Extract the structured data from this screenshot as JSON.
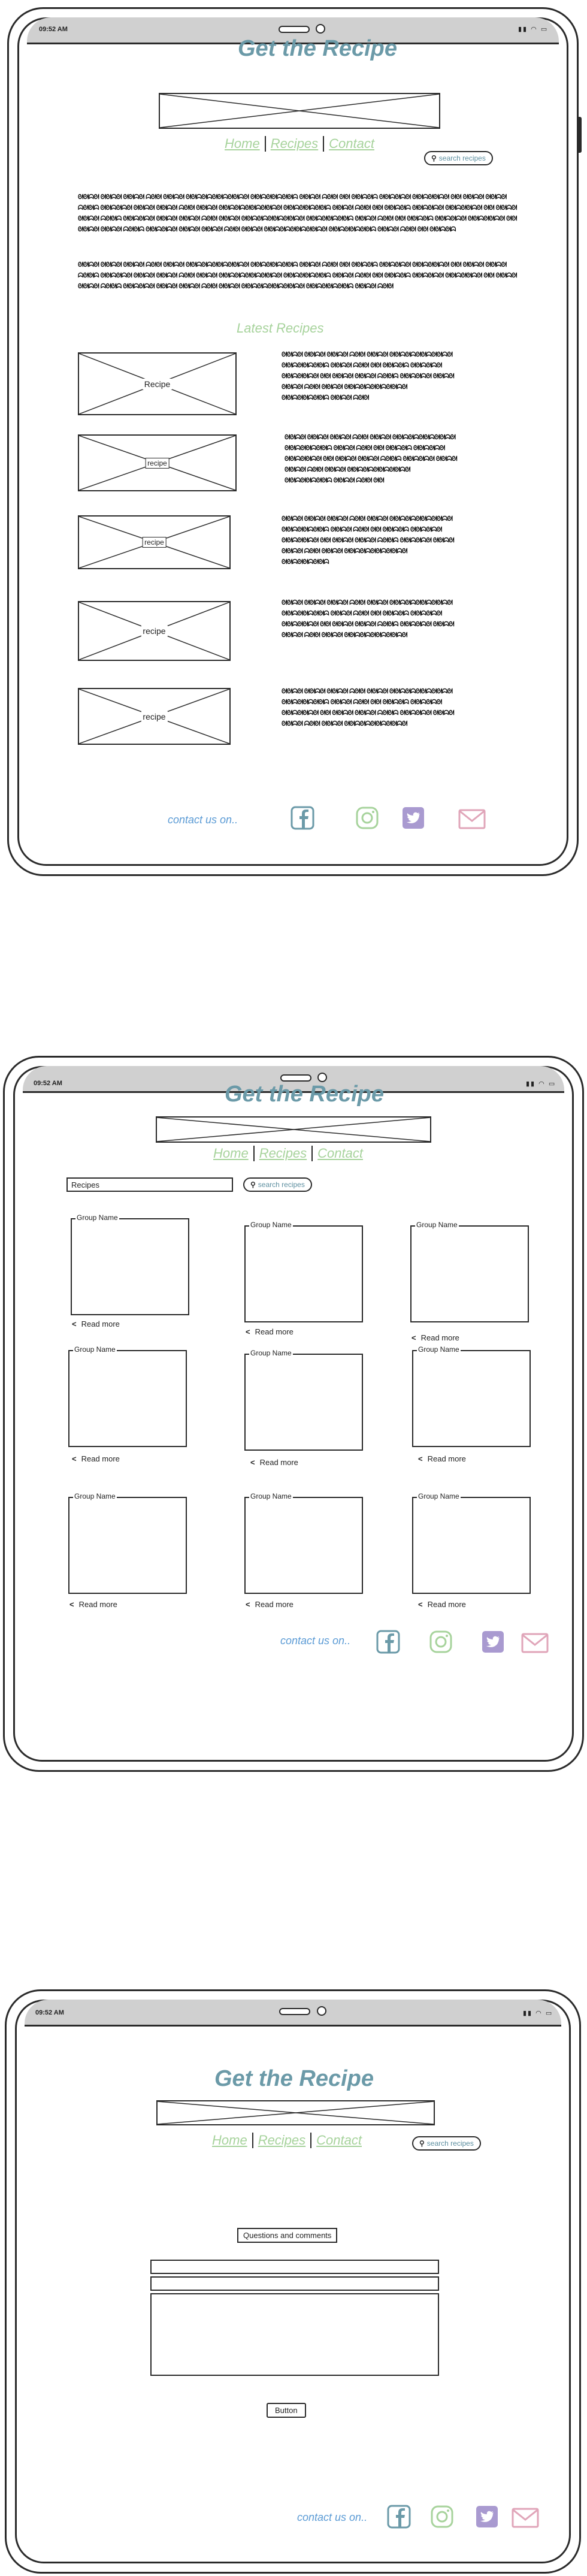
{
  "status": {
    "time": "09:52 AM",
    "icons": "▮▮ ◠ ▭"
  },
  "app": {
    "title": "Get the Recipe"
  },
  "nav": {
    "home": "Home",
    "recipes": "Recipes",
    "contact": "Contact"
  },
  "search": {
    "label": "search recipes",
    "icon": "search-icon"
  },
  "home": {
    "intro_p1": "ᘛᘛᗣᘛ ᘛᘛᗣᘛ ᘛᘛᗣᘛ ᗣᘛᘛ ᘛᘛᗣᘛ ᘛᘛᗣᘛᗣᘛᘛᗣᘛᘛᗣᘛ ᘛᘛᗣᘛᘛᗣᘛᘛᗣ ᘛᘛᗣᘛ ᗣᘛᘛ ᘛᘛ ᘛᘛᗣᘛᗣ ᘛᘛᗣᘛᗣᘛ ᘛᘛᗣᘛᘛᗣᘛ ᘛᘛ ᘛᘛᗣᘛ ᘛᘛᗣᘛ ᗣᘛᘛᗣ ᘛᘛᗣᘛᗣᘛ ᘛᘛᗣᘛ ᘛᘛᗣᘛ ᗣᘛᘛ ᘛᘛᗣᘛ ᘛᘛᗣᘛᗣᘛᘛᗣᘛᘛᗣᘛ ᘛᘛᗣᘛᘛᗣᘛᘛᗣ ᘛᘛᗣᘛ ᗣᘛᘛ ᘛᘛ ᘛᘛᗣᘛᗣ ᘛᘛᗣᘛᗣᘛ ᘛᘛᗣᘛᘛᗣᘛ ᘛᘛ ᘛᘛᗣᘛ ᘛᘛᗣᘛ ᗣᘛᘛᗣ ᘛᘛᗣᘛᗣᘛ ᘛᘛᗣᘛ ᘛᘛᗣᘛ ᗣᘛᘛ ᘛᘛᗣᘛ ᘛᘛᗣᘛᗣᘛᘛᗣᘛᘛᗣᘛ ᘛᘛᗣᘛᘛᗣᘛᘛᗣ ᘛᘛᗣᘛ ᗣᘛᘛ ᘛᘛ ᘛᘛᗣᘛᗣ ᘛᘛᗣᘛᗣᘛ ᘛᘛᗣᘛᘛᗣᘛ ᘛᘛ ᘛᘛᗣᘛ ᘛᘛᗣᘛ ᗣᘛᘛᗣ ᘛᘛᗣᘛᗣᘛ ᘛᘛᗣᘛ ᘛᘛᗣᘛ ᗣᘛᘛ ᘛᘛᗣᘛ ᘛᘛᗣᘛᗣᘛᘛᗣᘛᘛᗣᘛ ᘛᘛᗣᘛᘛᗣᘛᘛᗣ ᘛᘛᗣᘛ ᗣᘛᘛ ᘛᘛ ᘛᘛᗣᘛᗣ",
    "intro_p2": "ᘛᘛᗣᘛ ᘛᘛᗣᘛ ᘛᘛᗣᘛ ᗣᘛᘛ ᘛᘛᗣᘛ ᘛᘛᗣᘛᗣᘛᘛᗣᘛᘛᗣᘛ ᘛᘛᗣᘛᘛᗣᘛᘛᗣ ᘛᘛᗣᘛ ᗣᘛᘛ ᘛᘛ ᘛᘛᗣᘛᗣ ᘛᘛᗣᘛᗣᘛ ᘛᘛᗣᘛᘛᗣᘛ ᘛᘛ ᘛᘛᗣᘛ ᘛᘛᗣᘛ ᗣᘛᘛᗣ ᘛᘛᗣᘛᗣᘛ ᘛᘛᗣᘛ ᘛᘛᗣᘛ ᗣᘛᘛ ᘛᘛᗣᘛ ᘛᘛᗣᘛᗣᘛᘛᗣᘛᘛᗣᘛ ᘛᘛᗣᘛᘛᗣᘛᘛᗣ ᘛᘛᗣᘛ ᗣᘛᘛ ᘛᘛ ᘛᘛᗣᘛᗣ ᘛᘛᗣᘛᗣᘛ ᘛᘛᗣᘛᘛᗣᘛ ᘛᘛ ᘛᘛᗣᘛ ᘛᘛᗣᘛ ᗣᘛᘛᗣ ᘛᘛᗣᘛᗣᘛ ᘛᘛᗣᘛ ᘛᘛᗣᘛ ᗣᘛᘛ ᘛᘛᗣᘛ ᘛᘛᗣᘛᗣᘛᘛᗣᘛᘛᗣᘛ ᘛᘛᗣᘛᘛᗣᘛᘛᗣ ᘛᘛᗣᘛ ᗣᘛᘛ",
    "latest_title": "Latest Recipes",
    "recipes": [
      {
        "label": "Recipe",
        "desc": "ᘛᘛᗣᘛ ᘛᘛᗣᘛ ᘛᘛᗣᘛ ᗣᘛᘛ ᘛᘛᗣᘛ ᘛᘛᗣᘛᗣᘛᘛᗣᘛᘛᗣᘛ ᘛᘛᗣᘛᘛᗣᘛᘛᗣ ᘛᘛᗣᘛ ᗣᘛᘛ ᘛᘛ ᘛᘛᗣᘛᗣ ᘛᘛᗣᘛᗣᘛ ᘛᘛᗣᘛᘛᗣᘛ ᘛᘛ ᘛᘛᗣᘛ ᘛᘛᗣᘛ ᗣᘛᘛᗣ ᘛᘛᗣᘛᗣᘛ ᘛᘛᗣᘛ ᘛᘛᗣᘛ ᗣᘛᘛ ᘛᘛᗣᘛ ᘛᘛᗣᘛᗣᘛᘛᗣᘛᘛᗣᘛ ᘛᘛᗣᘛᘛᗣᘛᘛᗣ ᘛᘛᗣᘛ ᗣᘛᘛ"
      },
      {
        "label": "recipe",
        "desc": "ᘛᘛᗣᘛ ᘛᘛᗣᘛ ᘛᘛᗣᘛ ᗣᘛᘛ ᘛᘛᗣᘛ ᘛᘛᗣᘛᗣᘛᘛᗣᘛᘛᗣᘛ ᘛᘛᗣᘛᘛᗣᘛᘛᗣ ᘛᘛᗣᘛ ᗣᘛᘛ ᘛᘛ ᘛᘛᗣᘛᗣ ᘛᘛᗣᘛᗣᘛ ᘛᘛᗣᘛᘛᗣᘛ ᘛᘛ ᘛᘛᗣᘛ ᘛᘛᗣᘛ ᗣᘛᘛᗣ ᘛᘛᗣᘛᗣᘛ ᘛᘛᗣᘛ ᘛᘛᗣᘛ ᗣᘛᘛ ᘛᘛᗣᘛ ᘛᘛᗣᘛᗣᘛᘛᗣᘛᘛᗣᘛ ᘛᘛᗣᘛᘛᗣᘛᘛᗣ ᘛᘛᗣᘛ ᗣᘛᘛ ᘛᘛ"
      },
      {
        "label": "recipe",
        "desc": "ᘛᘛᗣᘛ ᘛᘛᗣᘛ ᘛᘛᗣᘛ ᗣᘛᘛ ᘛᘛᗣᘛ ᘛᘛᗣᘛᗣᘛᘛᗣᘛᘛᗣᘛ ᘛᘛᗣᘛᘛᗣᘛᘛᗣ ᘛᘛᗣᘛ ᗣᘛᘛ ᘛᘛ ᘛᘛᗣᘛᗣ ᘛᘛᗣᘛᗣᘛ ᘛᘛᗣᘛᘛᗣᘛ ᘛᘛ ᘛᘛᗣᘛ ᘛᘛᗣᘛ ᗣᘛᘛᗣ ᘛᘛᗣᘛᗣᘛ ᘛᘛᗣᘛ ᘛᘛᗣᘛ ᗣᘛᘛ ᘛᘛᗣᘛ ᘛᘛᗣᘛᗣᘛᘛᗣᘛᘛᗣᘛ ᘛᘛᗣᘛᘛᗣᘛᘛᗣ"
      },
      {
        "label": "recipe",
        "desc": "ᘛᘛᗣᘛ ᘛᘛᗣᘛ ᘛᘛᗣᘛ ᗣᘛᘛ ᘛᘛᗣᘛ ᘛᘛᗣᘛᗣᘛᘛᗣᘛᘛᗣᘛ ᘛᘛᗣᘛᘛᗣᘛᘛᗣ ᘛᘛᗣᘛ ᗣᘛᘛ ᘛᘛ ᘛᘛᗣᘛᗣ ᘛᘛᗣᘛᗣᘛ ᘛᘛᗣᘛᘛᗣᘛ ᘛᘛ ᘛᘛᗣᘛ ᘛᘛᗣᘛ ᗣᘛᘛᗣ ᘛᘛᗣᘛᗣᘛ ᘛᘛᗣᘛ ᘛᘛᗣᘛ ᗣᘛᘛ ᘛᘛᗣᘛ ᘛᘛᗣᘛᗣᘛᘛᗣᘛᘛᗣᘛ"
      },
      {
        "label": "recipe",
        "desc": "ᘛᘛᗣᘛ ᘛᘛᗣᘛ ᘛᘛᗣᘛ ᗣᘛᘛ ᘛᘛᗣᘛ ᘛᘛᗣᘛᗣᘛᘛᗣᘛᘛᗣᘛ ᘛᘛᗣᘛᘛᗣᘛᘛᗣ ᘛᘛᗣᘛ ᗣᘛᘛ ᘛᘛ ᘛᘛᗣᘛᗣ ᘛᘛᗣᘛᗣᘛ ᘛᘛᗣᘛᘛᗣᘛ ᘛᘛ ᘛᘛᗣᘛ ᘛᘛᗣᘛ ᗣᘛᘛᗣ ᘛᘛᗣᘛᗣᘛ ᘛᘛᗣᘛ ᘛᘛᗣᘛ ᗣᘛᘛ ᘛᘛᗣᘛ ᘛᘛᗣᘛᗣᘛᘛᗣᘛᘛᗣᘛ"
      }
    ]
  },
  "footer": {
    "contact": "contact us on..",
    "colors": {
      "facebook": "#6b9aa8",
      "instagram": "#a7d39c",
      "twitter": "#a99ad0",
      "mail": "#e0a5b9"
    }
  },
  "recipes_page": {
    "search_value": "Recipes",
    "group_name": "Group Name",
    "read_more": "Read more"
  },
  "contact_page": {
    "form_title": "Questions and comments",
    "button": "Button"
  }
}
